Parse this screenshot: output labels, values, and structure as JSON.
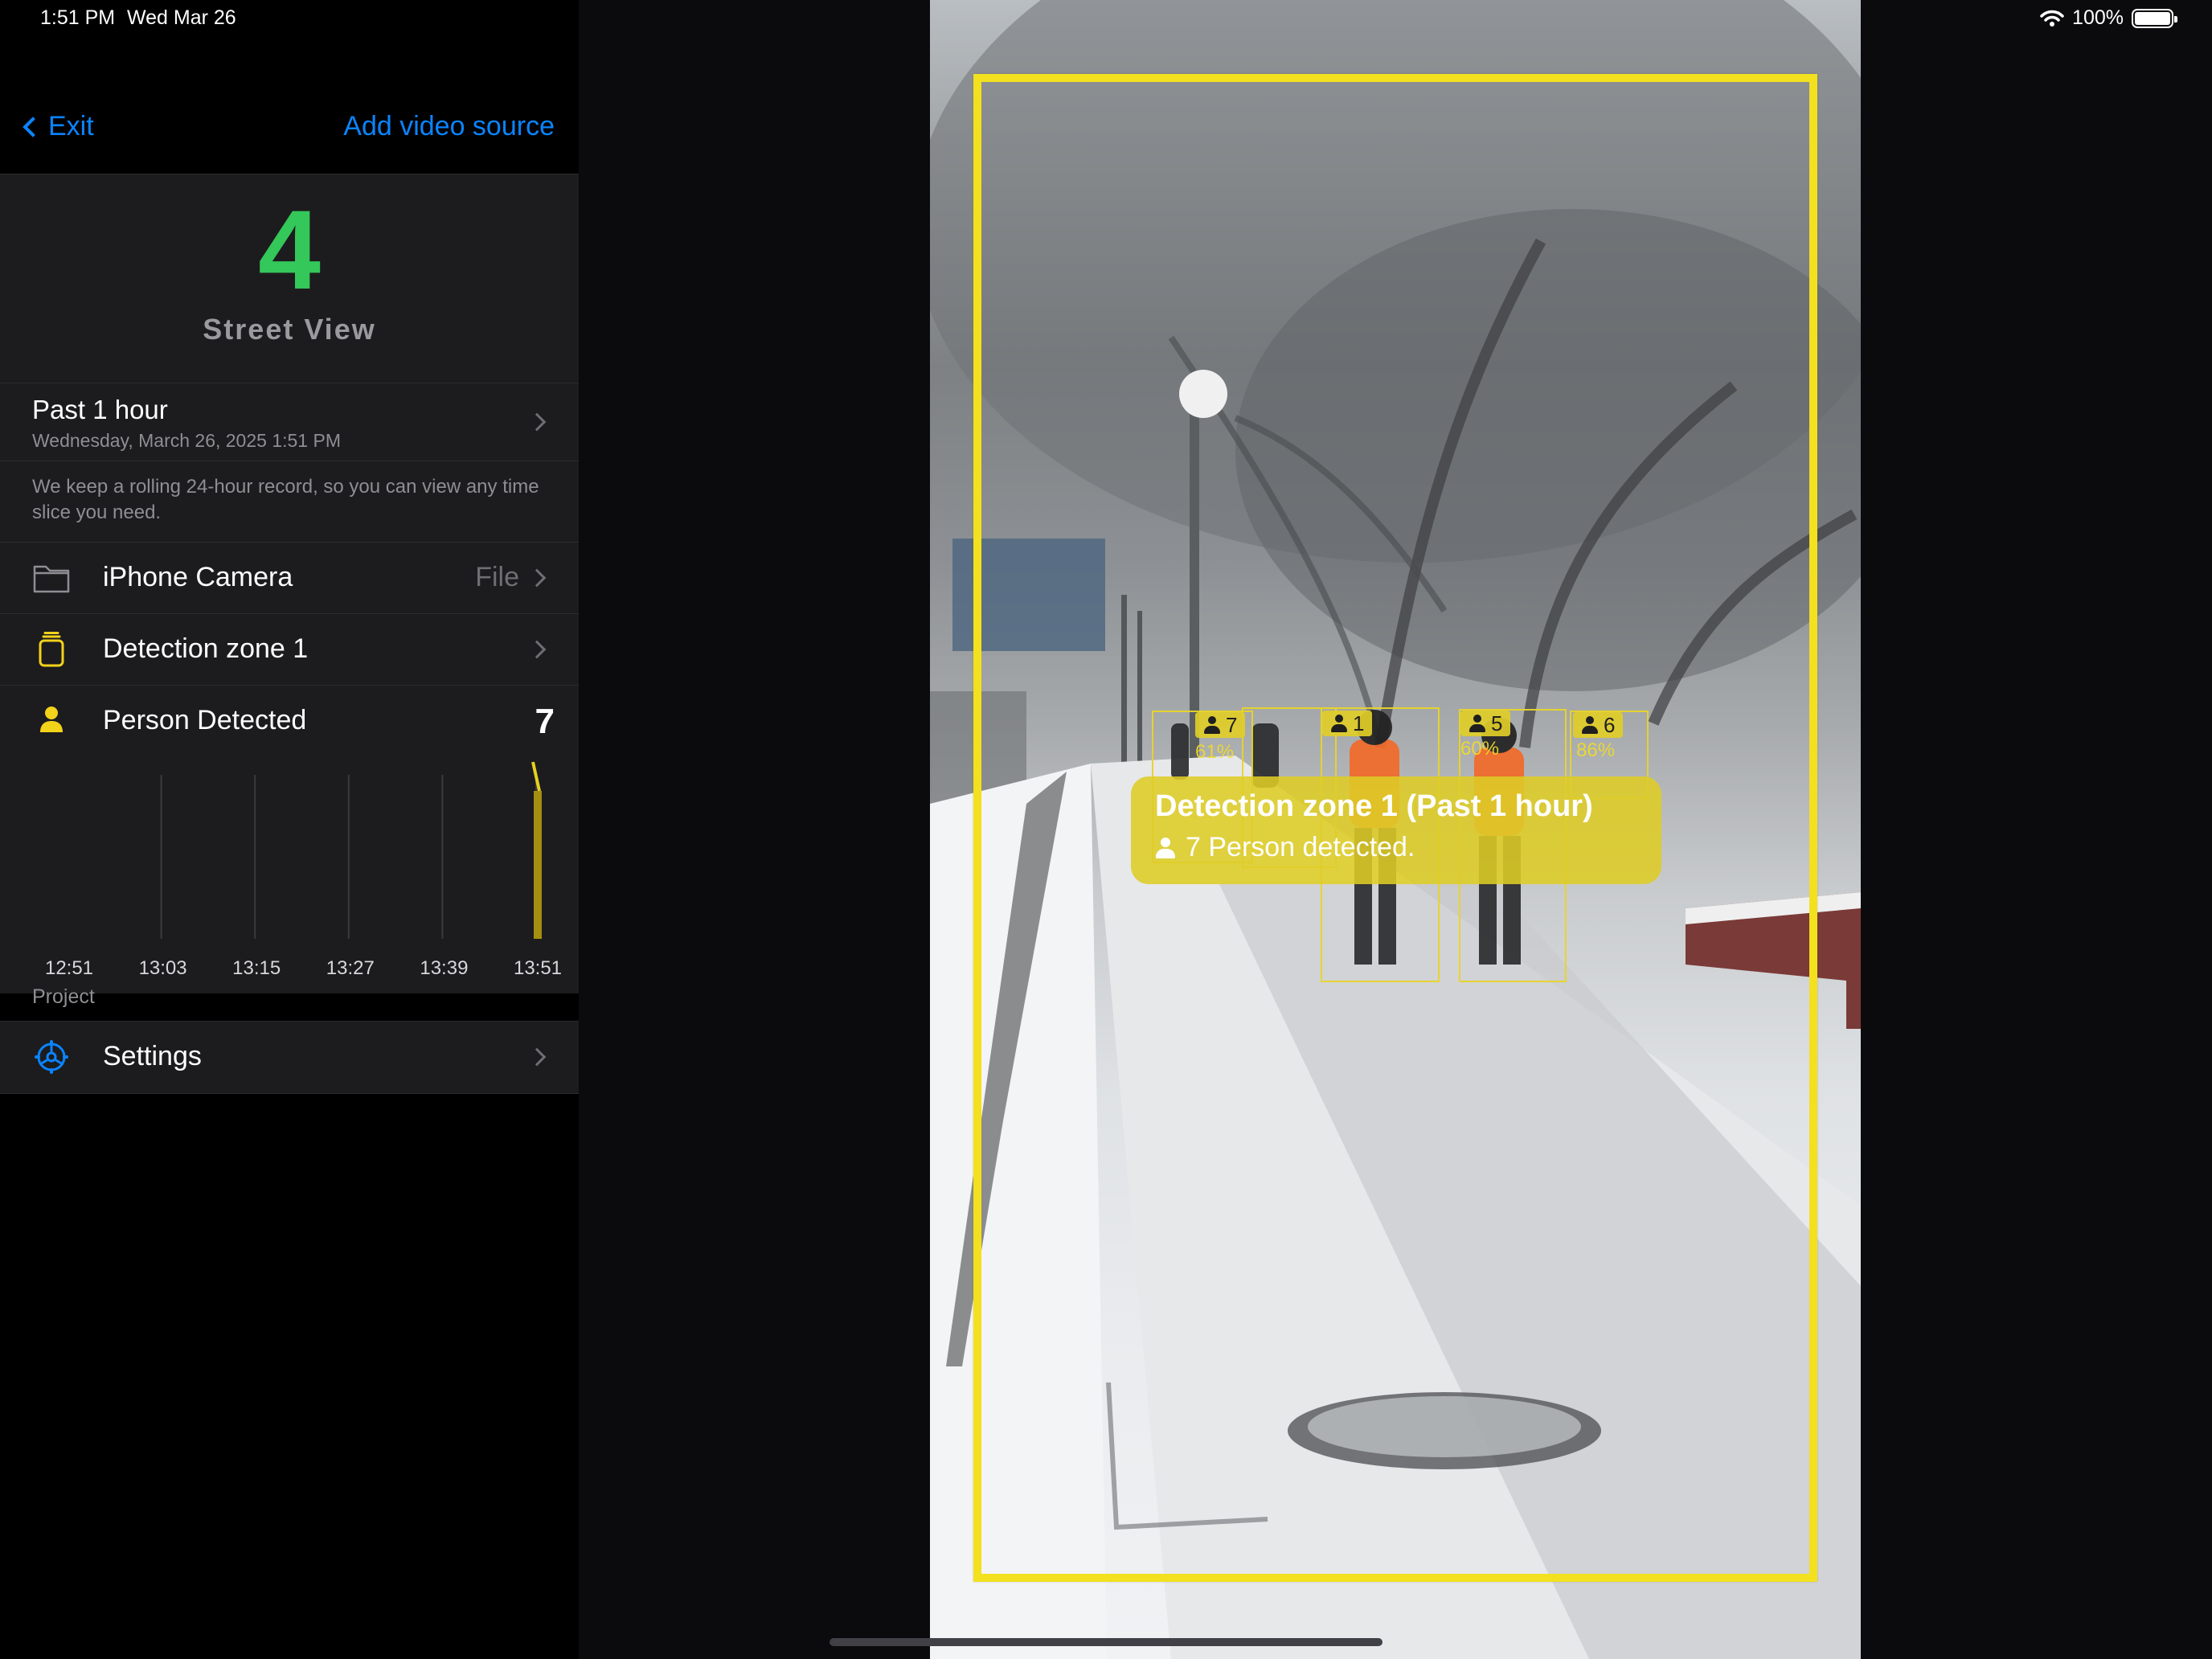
{
  "status_bar": {
    "time": "1:51 PM",
    "date": "Wed Mar 26",
    "battery": "100%"
  },
  "nav": {
    "back_label": "Exit",
    "add_label": "Add video source"
  },
  "header": {
    "count": "4",
    "camera_name": "Street View"
  },
  "time_range": {
    "title": "Past 1 hour",
    "subtitle": "Wednesday, March 26, 2025 1:51 PM"
  },
  "note": "We keep a rolling 24-hour record, so you can view any time slice you need.",
  "rows": {
    "source": {
      "label": "iPhone Camera",
      "detail": "File",
      "icon": "folder-icon"
    },
    "zone": {
      "label": "Detection zone 1",
      "icon": "zone-icon"
    },
    "person": {
      "label": "Person Detected",
      "count": "7",
      "icon": "person-icon"
    }
  },
  "chart_data": {
    "type": "bar",
    "x_labels": [
      "12:51",
      "13:03",
      "13:15",
      "13:27",
      "13:39",
      "13:51"
    ],
    "values": [
      0,
      0,
      0,
      0,
      0,
      7
    ],
    "ylim": [
      0,
      7
    ],
    "color": "#a38f10"
  },
  "project": {
    "section_label": "Project",
    "settings_label": "Settings"
  },
  "video": {
    "zone_popup": {
      "title": "Detection zone 1 (Past 1 hour)",
      "subtitle": "7 Person detected."
    },
    "detections": [
      {
        "id": "7",
        "confidence": "61%"
      },
      {
        "id": "1",
        "confidence": ""
      },
      {
        "id": "5",
        "confidence": "60%"
      },
      {
        "id": "6",
        "confidence": "86%"
      }
    ],
    "zone_color": "#f3e01f"
  },
  "colors": {
    "accent": "#0a84ff",
    "count_green": "#34c759",
    "zone_yellow": "#f3e01f"
  }
}
